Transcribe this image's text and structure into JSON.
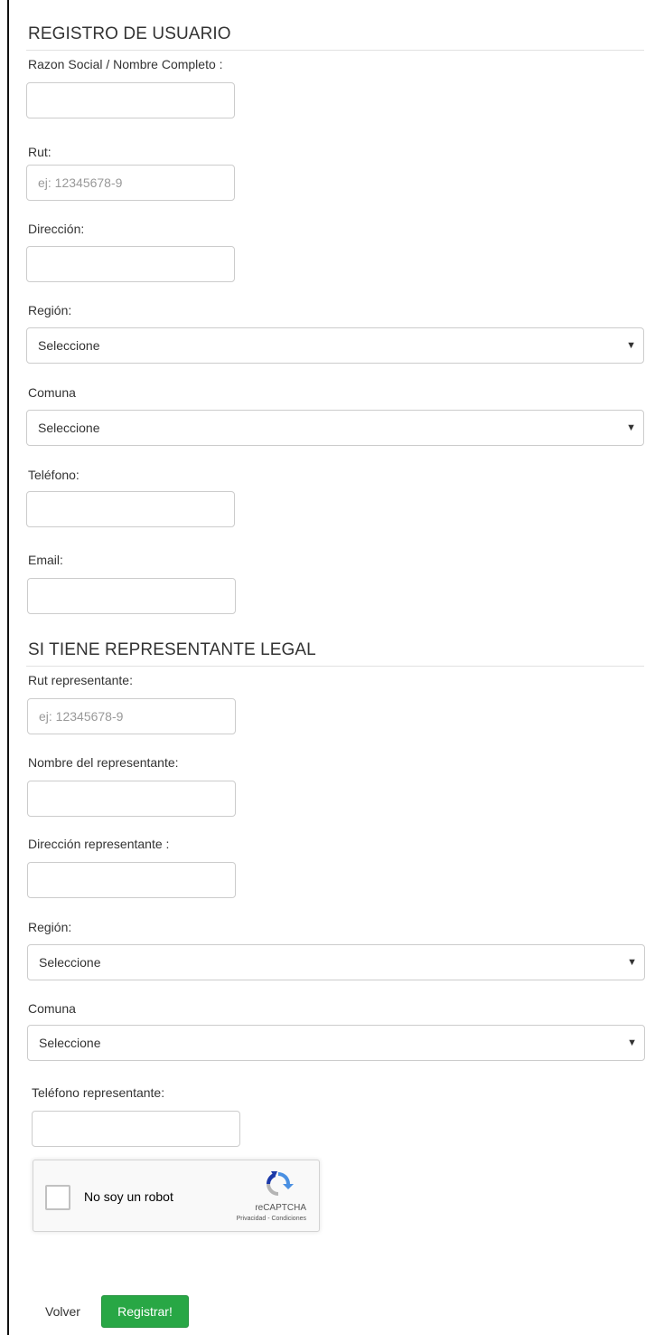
{
  "colors": {
    "accent_button": "#28a745",
    "border": "#cccccc"
  },
  "section1": {
    "title": "REGISTRO DE USUARIO",
    "razon_label": "Razon Social / Nombre Completo :",
    "rut_label": "Rut:",
    "rut_placeholder": "ej: 12345678-9",
    "direccion_label": "Dirección:",
    "region_label": "Región:",
    "region_value": "Seleccione",
    "comuna_label": "Comuna",
    "comuna_value": "Seleccione",
    "telefono_label": "Teléfono:",
    "email_label": "Email:"
  },
  "section2": {
    "title": "SI TIENE REPRESENTANTE LEGAL",
    "rut_label": "Rut representante:",
    "rut_placeholder": "ej: 12345678-9",
    "nombre_label": "Nombre del representante:",
    "direccion_label": "Dirección representante :",
    "region_label": "Región:",
    "region_value": "Seleccione",
    "comuna_label": "Comuna",
    "comuna_value": "Seleccione",
    "telefono_label": "Teléfono representante:"
  },
  "captcha": {
    "label": "No soy un robot",
    "brand": "reCAPTCHA",
    "terms": "Privacidad - Condiciones",
    "icon": "recaptcha-icon"
  },
  "actions": {
    "back_label": "Volver",
    "submit_label": "Registrar!"
  },
  "icons": {
    "select_arrow": "chevron-down-icon"
  }
}
